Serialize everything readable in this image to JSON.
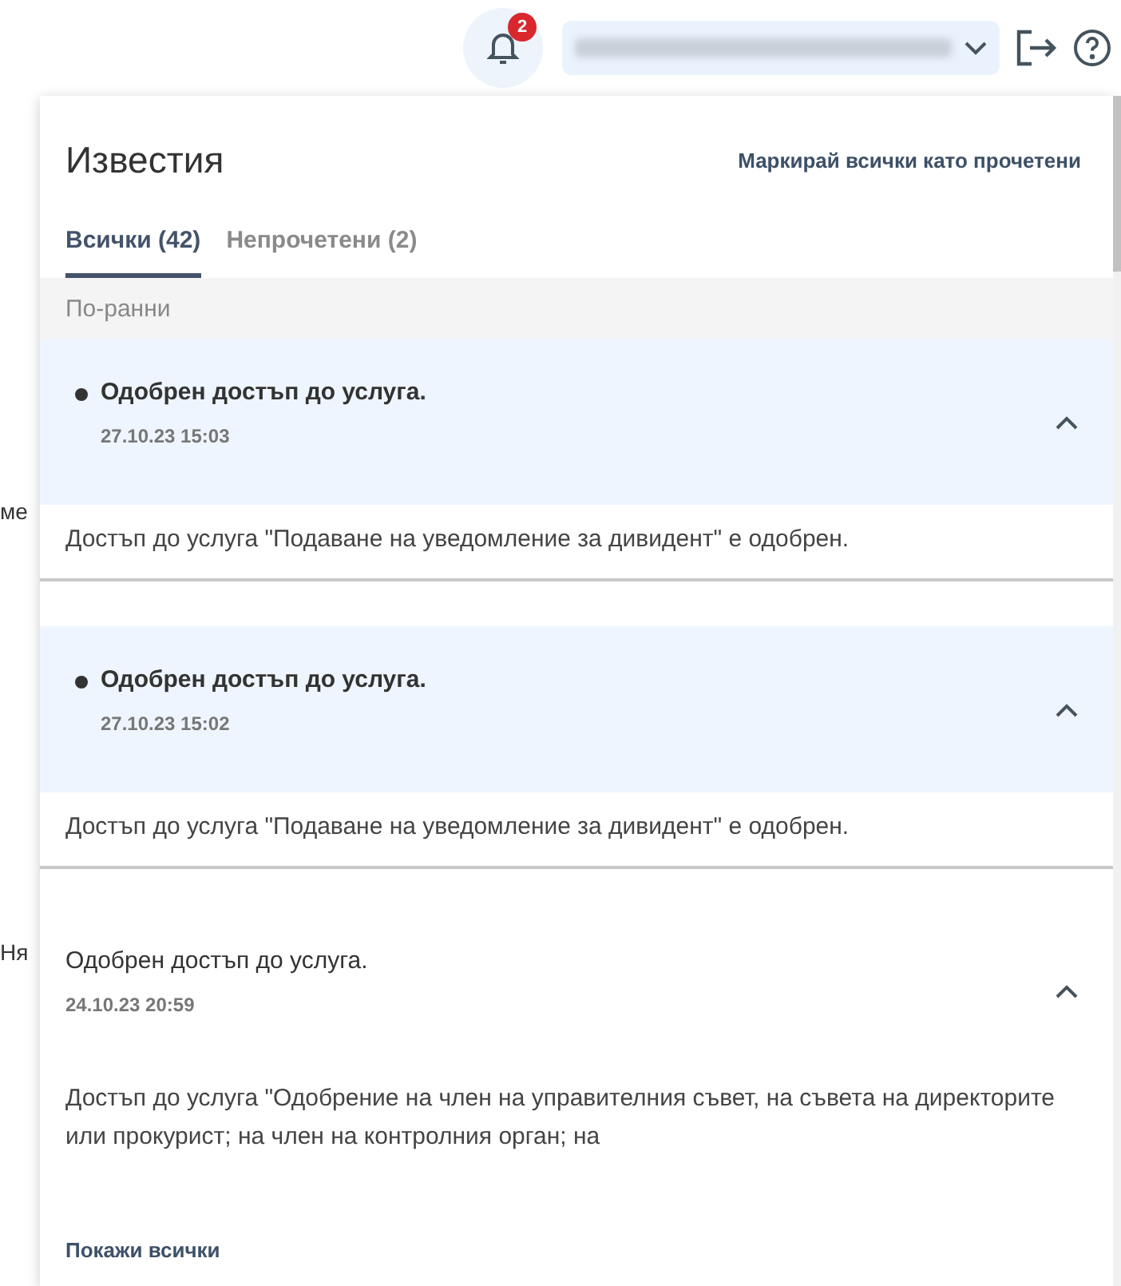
{
  "topbar": {
    "notification_count": "2",
    "background_fragments": [
      "ме",
      "Ня"
    ]
  },
  "panel": {
    "title": "Известия",
    "mark_all": "Маркирай всички като прочетени",
    "tabs": [
      {
        "label": "Всички (42)",
        "selected": true
      },
      {
        "label": "Непрочетени (2)",
        "selected": false
      }
    ],
    "group_label": "По-ранни",
    "notifications": [
      {
        "title": "Одобрен достъп до услуга.",
        "time": "27.10.23 15:03",
        "unread": true,
        "expanded": true,
        "body": "Достъп до услуга \"Подаване на уведомление за дивидент\" е одобрен."
      },
      {
        "title": "Одобрен достъп до услуга.",
        "time": "27.10.23 15:02",
        "unread": true,
        "expanded": true,
        "body": "Достъп до услуга \"Подаване на уведомление за дивидент\" е одобрен."
      },
      {
        "title": "Одобрен достъп до услуга.",
        "time": "24.10.23 20:59",
        "unread": false,
        "expanded": true,
        "body": "Достъп до услуга \"Одобрение на член на управителния съвет, на съвета на директорите или прокурист; на член на контролния орган; на"
      }
    ],
    "show_all": "Покажи всички"
  }
}
